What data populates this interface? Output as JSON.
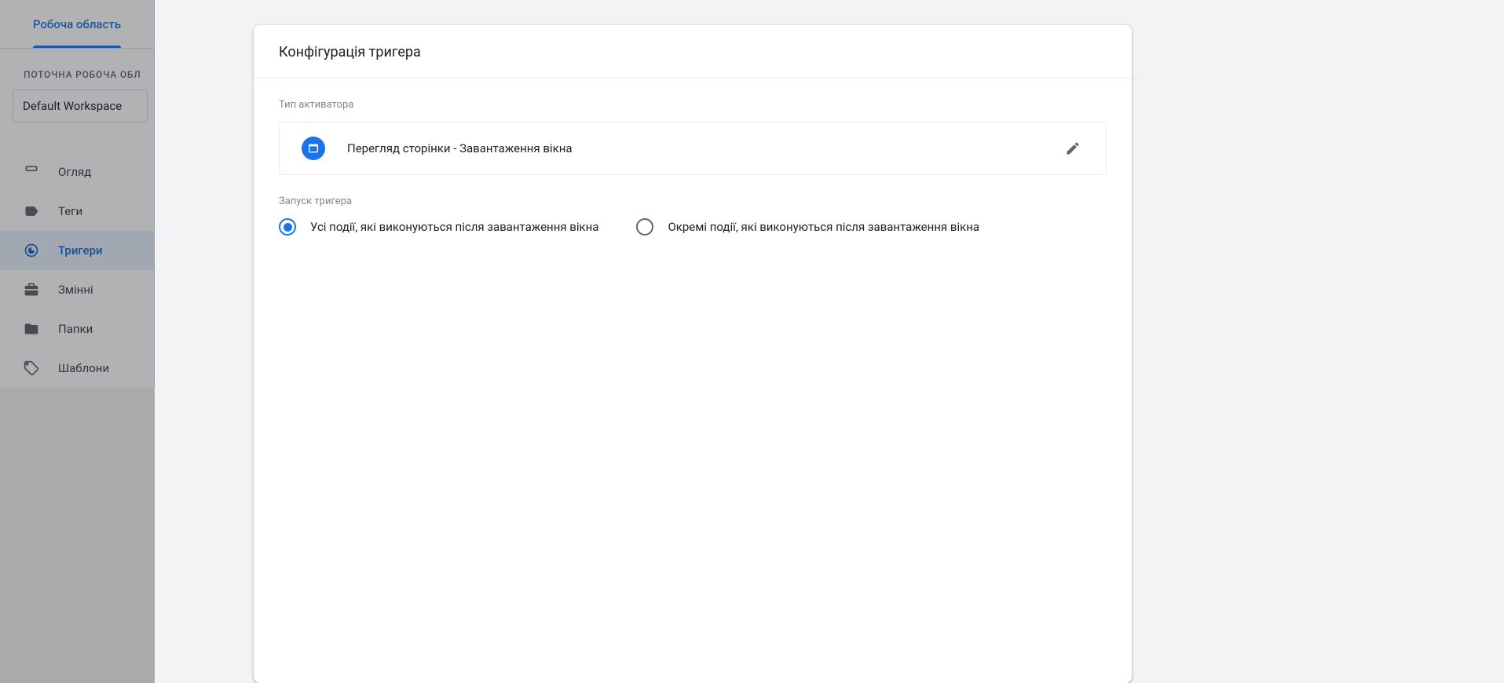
{
  "sidebar": {
    "tab_workspace": "Робоча область",
    "workspace_section_label": "ПОТОЧНА РОБОЧА ОБЛ",
    "workspace_selected": "Default Workspace",
    "nav": [
      {
        "label": "Огляд"
      },
      {
        "label": "Теги"
      },
      {
        "label": "Тригери"
      },
      {
        "label": "Змінні"
      },
      {
        "label": "Папки"
      },
      {
        "label": "Шаблони"
      }
    ]
  },
  "card": {
    "title": "Конфігурація тригера",
    "activator_section_label": "Тип активатора",
    "activator_value": "Перегляд сторінки - Завантаження вікна",
    "trigger_fire_label": "Запуск тригера",
    "radio_all": "Усі події, які виконуються після завантаження вікна",
    "radio_some": "Окремі події, які виконуються після завантаження вікна"
  }
}
